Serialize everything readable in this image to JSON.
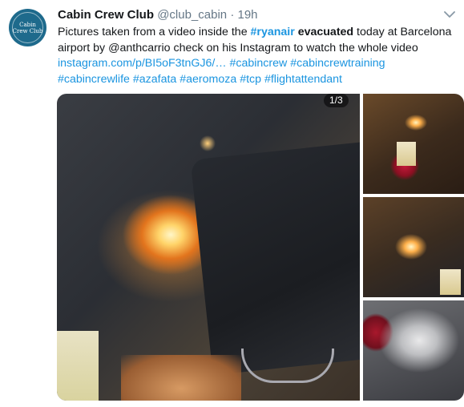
{
  "tweet": {
    "author_name": "Cabin Crew Club",
    "author_handle": "@club_cabin",
    "separator": "·",
    "timestamp": "19h",
    "avatar_text_line1": "Cabin",
    "avatar_text_line2": "Crew Club",
    "text_parts": {
      "p1": "Pictures taken from a video inside the ",
      "hashtag_ryanair": "#ryanair",
      "space1": " ",
      "evacuated": "evacuated",
      "p2": " today at Barcelona airport by @anthcarrio check on his Instagram to watch the whole video ",
      "link": "instagram.com/p/BI5oF3tnGJ6/…",
      "space2": " ",
      "tag1": "#cabincrew",
      "space3": " ",
      "tag2": "#cabincrewtraining",
      "space4": " ",
      "tag3": "#cabincrewlife",
      "space5": " ",
      "tag4": "#azafata",
      "space6": " ",
      "tag5": "#aeromoza",
      "space7": " ",
      "tag6": "#tcp",
      "space8": " ",
      "tag7": "#flightattendant"
    },
    "media_counter": "1/3",
    "colors": {
      "link": "#1b95e0",
      "secondary_text": "#657786",
      "avatar_bg": "#1e6a8c"
    },
    "icons": {
      "caret": "chevron-down-icon"
    }
  }
}
